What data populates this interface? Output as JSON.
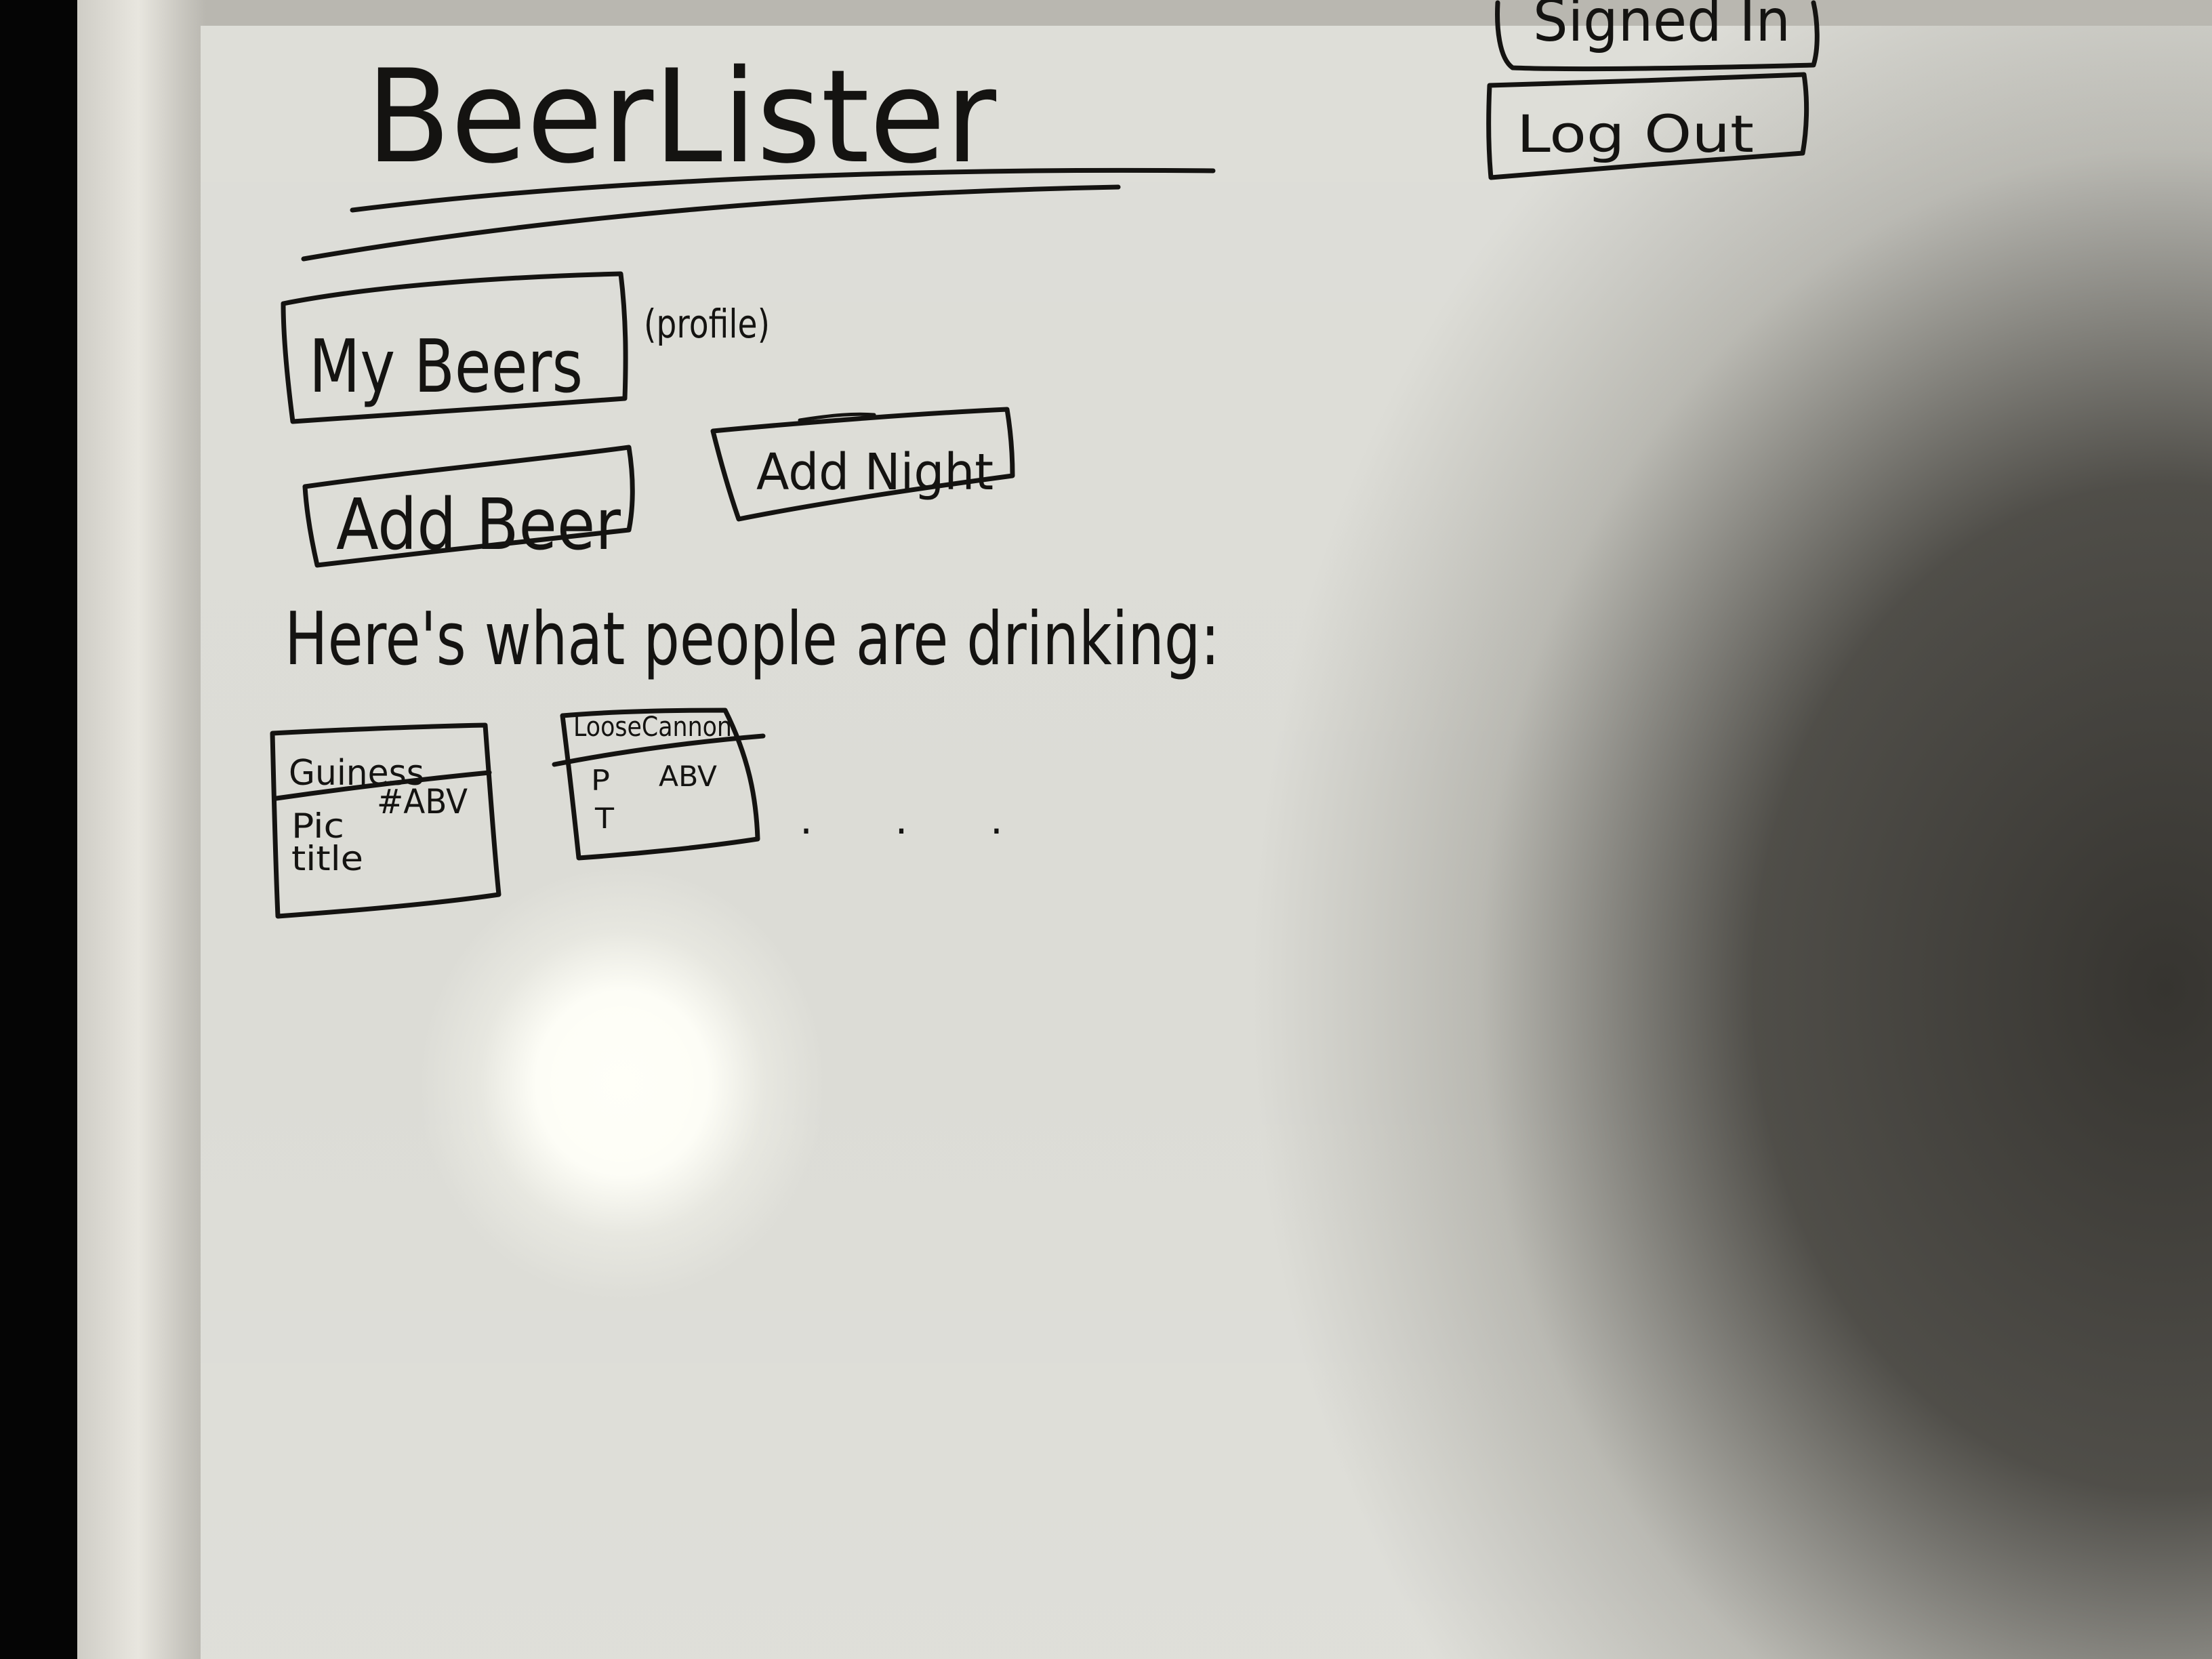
{
  "app": {
    "title": "BeerLister"
  },
  "header": {
    "signed_in_label": "Signed In",
    "logout_label": "Log Out"
  },
  "nav": {
    "my_beers_label": "My Beers",
    "my_beers_note": "(profile)",
    "add_beer_label": "Add Beer",
    "add_night_label": "Add Night"
  },
  "feed": {
    "heading": "Here's what people are drinking:",
    "cards": [
      {
        "name": "Guiness",
        "pic_label": "Pic",
        "abv_label": "#ABV",
        "title_label": "title"
      },
      {
        "name": "LooseCannon",
        "pic_label": "P",
        "pic_label2": "T",
        "abv_label": "ABV"
      }
    ],
    "more_indicator": ". . ."
  },
  "colors": {
    "marker_ink": "#141311",
    "whiteboard": "#dcdcd6",
    "frame": "#cfcdc6"
  }
}
